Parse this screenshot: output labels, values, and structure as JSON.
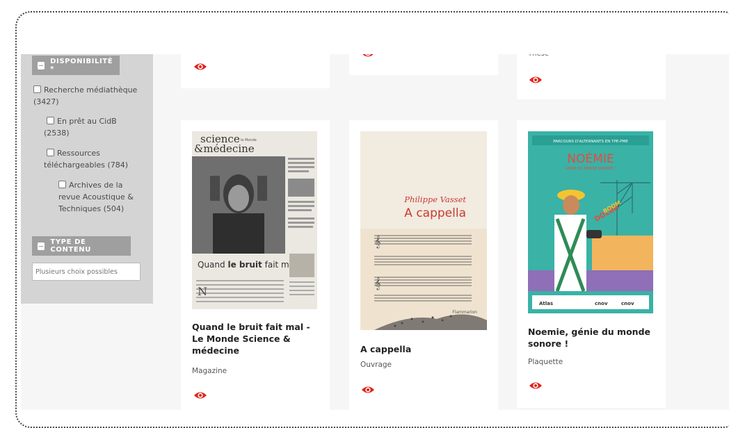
{
  "sidebar": {
    "availability_title": "DISPONIBILITÉ *",
    "options": [
      {
        "label_line1": "Recherche médiathèque",
        "label_line2": "(3427)"
      },
      {
        "label_line1": "En prêt au CidB",
        "label_line2": "(2538)"
      },
      {
        "label_line1": "Ressources",
        "label_line2": "téléchargeables (784)"
      },
      {
        "label_line1": "Archives de la",
        "label_line2": "revue Acoustique &",
        "label_line3": "Techniques (504)"
      }
    ],
    "content_type_title": "TYPE DE CONTENU",
    "content_type_placeholder": "Plusieurs choix possibles"
  },
  "top_row": {
    "card3_type": "Thèse"
  },
  "cards": [
    {
      "title": "Quand le bruit fait mal - Le Monde Science & médecine",
      "title_lines": [
        "Quand le bruit fait mal -",
        "Le Monde Science &",
        "médecine"
      ],
      "type": "Magazine",
      "cover": {
        "masthead1": "science",
        "masthead2": "médecine",
        "masthead_small": "le Monde",
        "headline_light": "Quand ",
        "headline_bold": "le bruit",
        "headline_tail": " fait mal"
      }
    },
    {
      "title": "A cappella",
      "title_lines": [
        "A cappella"
      ],
      "type": "Ouvrage",
      "cover": {
        "author": "Philippe Vasset",
        "book_title": "A cappella",
        "publisher": "Flammarion"
      }
    },
    {
      "title": "Noemie, génie du monde sonore !",
      "title_lines": [
        "Noemie, génie du monde",
        "sonore !"
      ],
      "type": "Plaquette",
      "cover": {
        "banner": "PARCOURS D'ALTERNANTS EN TPE-PME",
        "name": "NOÉMIE",
        "subtitle": "GÉNIE DU MONDE SONORE !",
        "footer_logos": [
          "Atlas",
          "cnov",
          "cnov"
        ]
      }
    }
  ],
  "icons": {
    "view": "eye-icon"
  },
  "colors": {
    "accent": "#e2231a",
    "sidebar_bg": "#d4d4d4",
    "facet_title_bg": "#9f9f9f",
    "page_bg": "#f6f6f6"
  }
}
